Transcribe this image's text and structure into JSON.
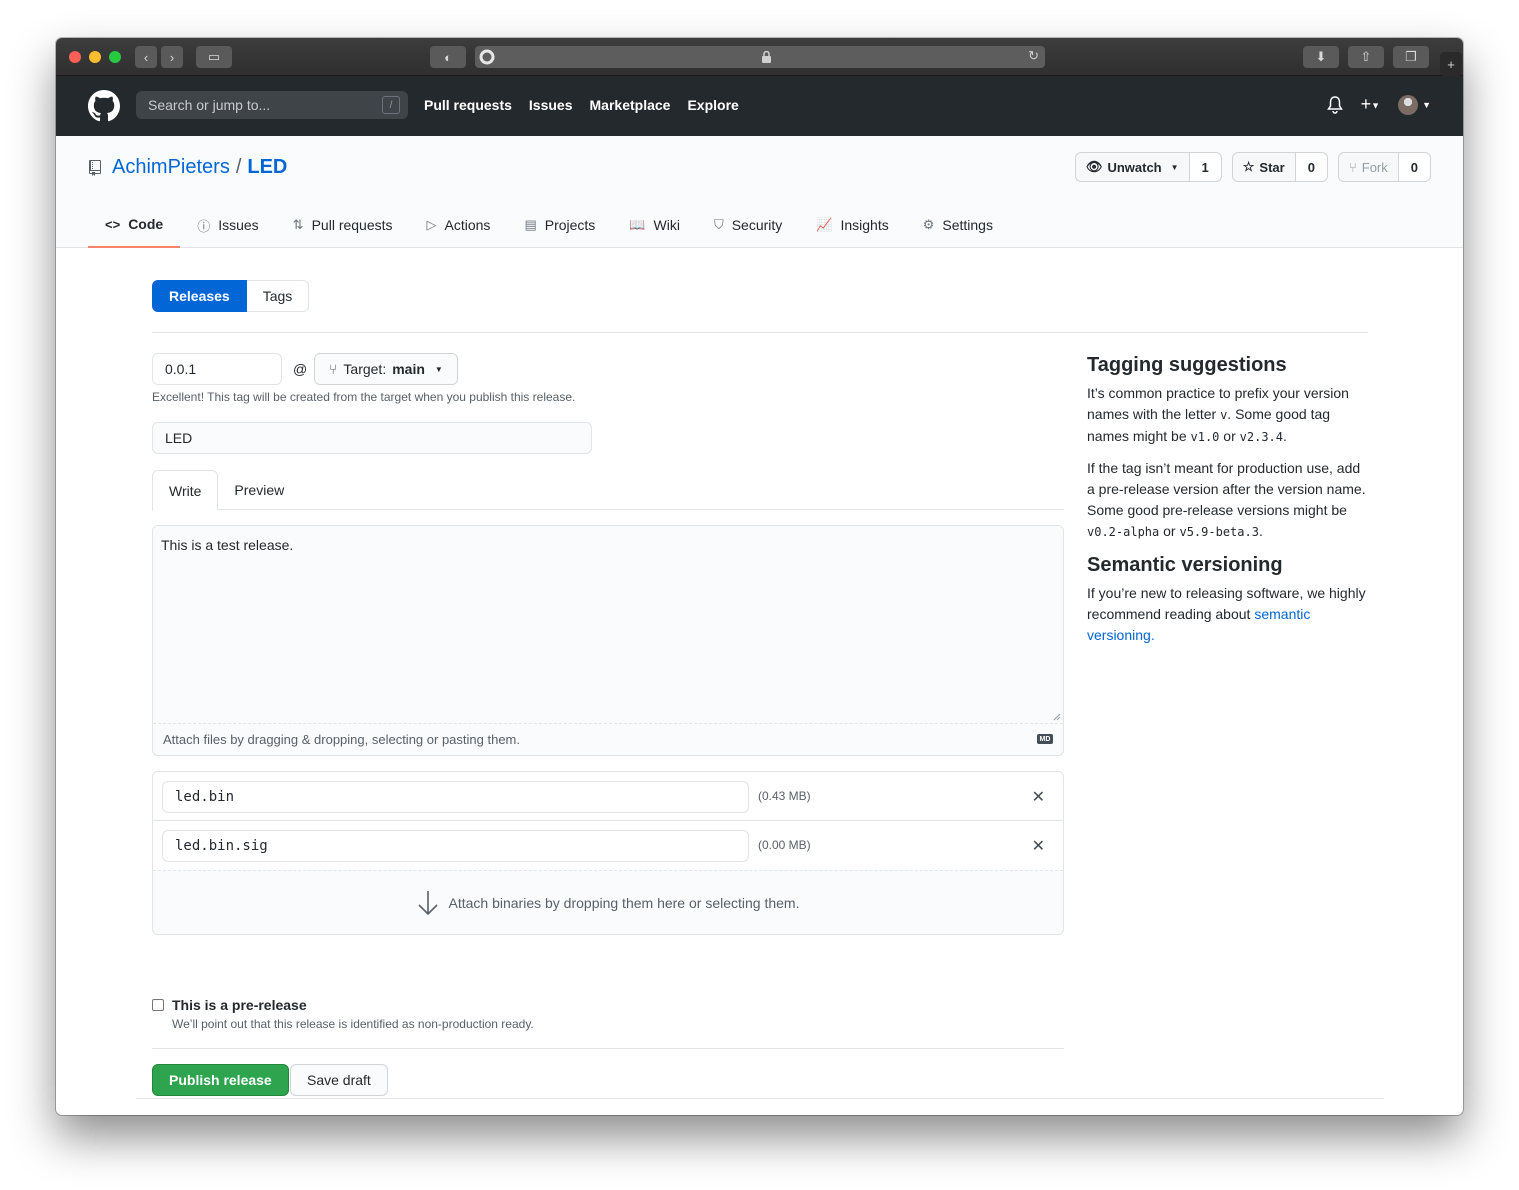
{
  "browser": {
    "address_lock": "lock-icon"
  },
  "gh": {
    "search_placeholder": "Search or jump to...",
    "search_key": "/",
    "nav": [
      "Pull requests",
      "Issues",
      "Marketplace",
      "Explore"
    ]
  },
  "repo": {
    "owner": "AchimPieters",
    "separator": "/",
    "name": "LED",
    "watch": {
      "label": "Unwatch",
      "count": "1"
    },
    "star": {
      "label": "Star",
      "count": "0"
    },
    "fork": {
      "label": "Fork",
      "count": "0"
    },
    "tabs": [
      "Code",
      "Issues",
      "Pull requests",
      "Actions",
      "Projects",
      "Wiki",
      "Security",
      "Insights",
      "Settings"
    ]
  },
  "subnav": {
    "releases": "Releases",
    "tags": "Tags"
  },
  "form": {
    "tag_value": "0.0.1",
    "at": "@",
    "target_label": "Target:",
    "target_branch": "main",
    "tag_note": "Excellent! This tag will be created from the target when you publish this release.",
    "title_value": "LED",
    "write_tab": "Write",
    "preview_tab": "Preview",
    "body": "This is a test release.",
    "attach_note": "Attach files by dragging & dropping, selecting or pasting them.",
    "md_badge": "MD",
    "files": [
      {
        "name": "led.bin",
        "size": "(0.43 MB)"
      },
      {
        "name": "led.bin.sig",
        "size": "(0.00 MB)"
      }
    ],
    "drop_text": "Attach binaries by dropping them here or selecting them.",
    "prerelease_label": "This is a pre-release",
    "prerelease_note": "We’ll point out that this release is identified as non-production ready.",
    "publish": "Publish release",
    "save_draft": "Save draft"
  },
  "sidebar": {
    "h1": "Tagging suggestions",
    "p1a": "It’s common practice to prefix your version names with the letter ",
    "p1_code1": "v",
    "p1b": ". Some good tag names might be ",
    "p1_code2": "v1.0",
    "p1c": " or ",
    "p1_code3": "v2.3.4",
    "p1d": ".",
    "p2a": "If the tag isn’t meant for production use, add a pre-release version after the version name. Some good pre-release versions might be ",
    "p2_code1": "v0.2-alpha",
    "p2b": " or ",
    "p2_code2": "v5.9-beta.3",
    "p2c": ".",
    "h2": "Semantic versioning",
    "p3": "If you’re new to releasing software, we highly recommend reading about ",
    "p3_link": "semantic versioning."
  }
}
